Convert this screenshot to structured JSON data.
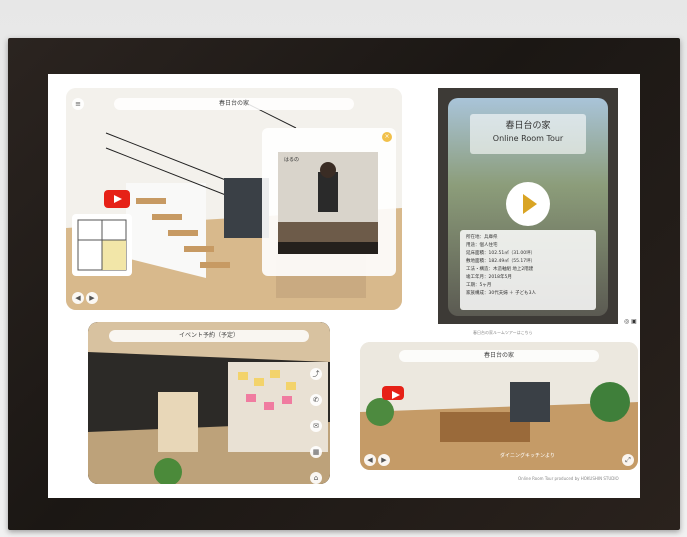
{
  "tour_a": {
    "title_pill": "春日台の家",
    "logo_glyph": "✿",
    "video_label": "はるの"
  },
  "tour_b": {
    "title_jp": "春日台の家",
    "title_en": "Online Room Tour",
    "info_lines": [
      "所在地：兵庫県",
      "用途：個人住宅",
      "延床面積：102.51㎡（31.00坪）",
      "敷地面積：182.49㎡（55.17坪）",
      "工法・構造：木造軸組 地上2階建",
      "竣工年月：2018年5月",
      "工期：5ヶ月",
      "家族構成：30代夫婦 ＋ 子ども3人"
    ],
    "caption": "春日台の家ルームツアーはこちら"
  },
  "tour_c": {
    "title_pill": "イベント予約（予定）"
  },
  "tour_d": {
    "title_pill": "春日台の家",
    "bottom_label": "ダイニングキッチンより",
    "footer_caption": "Online Room Tour produced by HOKUSHIN STUDIO"
  }
}
